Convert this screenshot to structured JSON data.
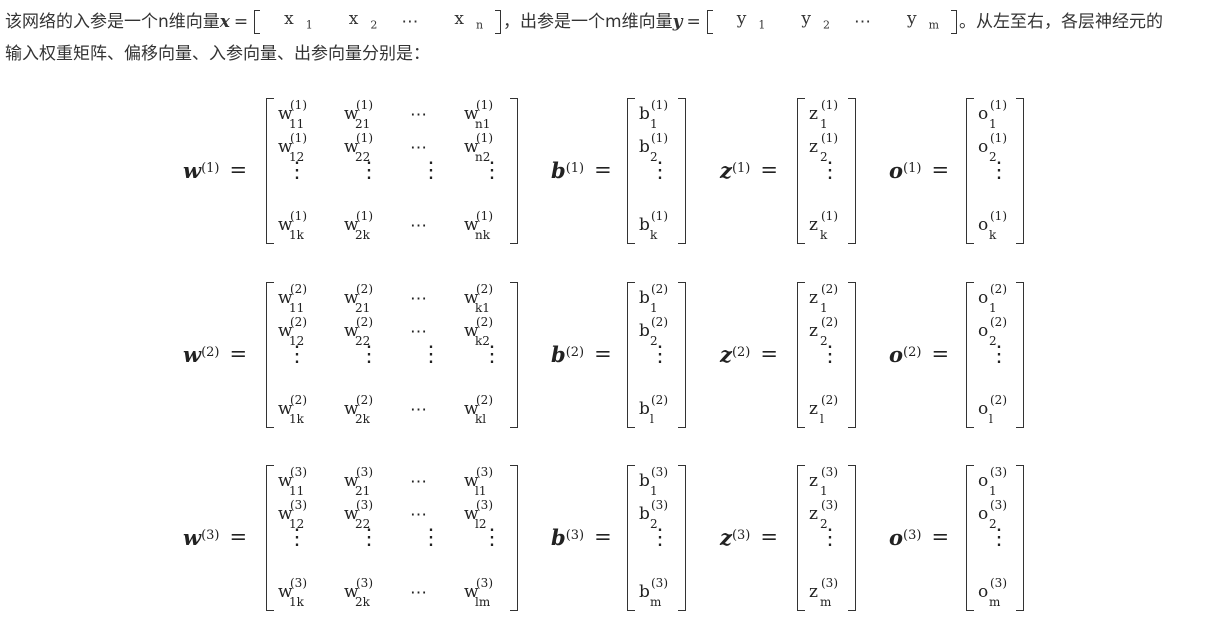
{
  "intro": {
    "text_a": "该网络的入参是一个n维向量",
    "x_symbol": "x",
    "x_elements": [
      "x",
      "x",
      "⋯",
      "x"
    ],
    "x_subscripts": [
      "1",
      "2",
      "",
      "n"
    ],
    "text_b": "，出参是一个m维向量",
    "y_symbol": "y",
    "y_elements": [
      "y",
      "y",
      "⋯",
      "y"
    ],
    "y_subscripts": [
      "1",
      "2",
      "",
      "m"
    ],
    "text_c": "。从左至右，各层神经元的",
    "line2": "输入权重矩阵、偏移向量、入参向量、出参向量分别是："
  },
  "equals": "=",
  "layers": [
    {
      "sup": "(1)",
      "w_sub": [
        "11",
        "21",
        "n1",
        "12",
        "22",
        "n2",
        "1k",
        "2k",
        "nk"
      ],
      "b_sub": [
        "1",
        "2",
        "k"
      ],
      "z_sub": [
        "1",
        "2",
        "k"
      ],
      "o_sub": [
        "1",
        "2",
        "k"
      ]
    },
    {
      "sup": "(2)",
      "w_sub": [
        "11",
        "21",
        "k1",
        "12",
        "22",
        "k2",
        "1k",
        "2k",
        "kl"
      ],
      "b_sub": [
        "1",
        "2",
        "l"
      ],
      "z_sub": [
        "1",
        "2",
        "l"
      ],
      "o_sub": [
        "1",
        "2",
        "l"
      ]
    },
    {
      "sup": "(3)",
      "w_sub": [
        "11",
        "21",
        "l1",
        "12",
        "22",
        "l2",
        "1k",
        "2k",
        "lm"
      ],
      "b_sub": [
        "1",
        "2",
        "m"
      ],
      "z_sub": [
        "1",
        "2",
        "m"
      ],
      "o_sub": [
        "1",
        "2",
        "m"
      ]
    }
  ],
  "symbols": {
    "w": "w",
    "b": "b",
    "z": "z",
    "o": "o"
  },
  "hdots": "⋯",
  "vdots": "⋮"
}
